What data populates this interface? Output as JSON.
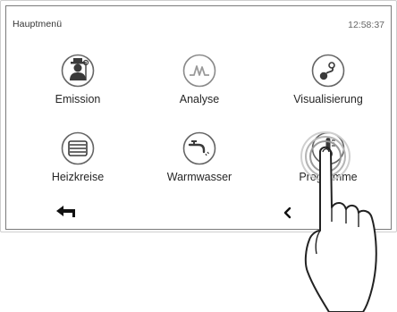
{
  "header": {
    "title": "Hauptmenü",
    "clock": "12:58:37"
  },
  "menu": {
    "items": [
      {
        "label": "Emission",
        "icon": "chimney-sweep-icon"
      },
      {
        "label": "Analyse",
        "icon": "analysis-wave-icon"
      },
      {
        "label": "Visualisierung",
        "icon": "visualization-icon"
      },
      {
        "label": "Heizkreise",
        "icon": "radiator-icon"
      },
      {
        "label": "Warmwasser",
        "icon": "faucet-icon"
      },
      {
        "label": "Programme",
        "icon": "thermometer-icon"
      }
    ]
  },
  "footer": {
    "back_icon": "back-arrow-icon",
    "prev_icon": "chevron-left-icon"
  },
  "colors": {
    "icon_fill": "#3a3a3a",
    "icon_light": "#9a9a9a",
    "icon_ring": "#666666",
    "frame_border": "#7a7a7a"
  }
}
